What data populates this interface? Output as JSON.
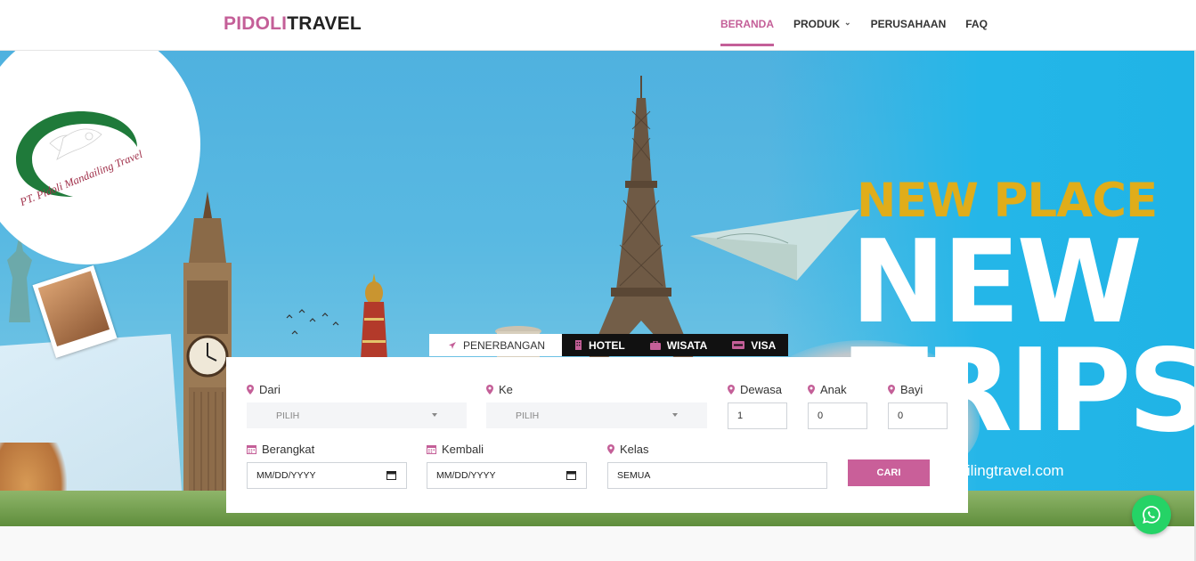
{
  "brand": {
    "part1": "PIDOLI",
    "part2": "TRAVEL"
  },
  "nav": {
    "items": [
      {
        "label": "BERANDA",
        "active": true
      },
      {
        "label": "PRODUK",
        "dropdown": true
      },
      {
        "label": "PERUSAHAAN"
      },
      {
        "label": "FAQ"
      }
    ]
  },
  "hero": {
    "logo_text": "PT. Pidoli Mandailing Travel",
    "headline_small": "NEW PLACE",
    "headline_big_1": "NEW",
    "headline_big_2": "TRIPS",
    "site_url": "dailingtravel.com"
  },
  "search": {
    "tabs": [
      {
        "label": "PENERBANGAN",
        "icon": "plane-icon",
        "active": true
      },
      {
        "label": "HOTEL",
        "icon": "building-icon"
      },
      {
        "label": "WISATA",
        "icon": "briefcase-icon"
      },
      {
        "label": "VISA",
        "icon": "visa-card-icon"
      }
    ],
    "from_label": "Dari",
    "from_value": "PILIH",
    "to_label": "Ke",
    "to_value": "PILIH",
    "adult_label": "Dewasa",
    "adult_value": "1",
    "child_label": "Anak",
    "child_value": "0",
    "infant_label": "Bayi",
    "infant_value": "0",
    "depart_label": "Berangkat",
    "depart_value": "MM/DD/YYYY",
    "return_label": "Kembali",
    "return_value": "MM/DD/YYYY",
    "class_label": "Kelas",
    "class_value": "SEMUA",
    "submit_label": "CARI"
  },
  "colors": {
    "accent": "#c45f98",
    "whatsapp": "#25d366",
    "headline_gold": "#e0ad1a"
  }
}
